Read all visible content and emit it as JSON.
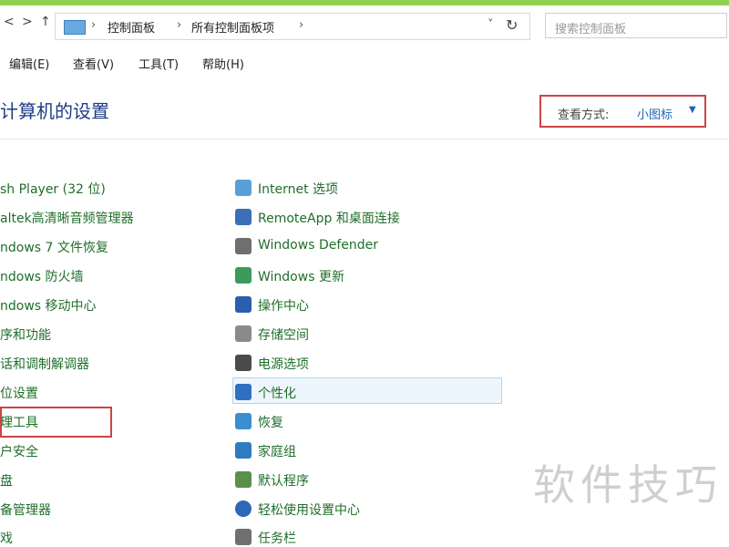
{
  "address_bar": {
    "back_symbol": "<",
    "forward_symbol": ">",
    "up_symbol": "↑",
    "breadcrumbs": [
      "控制面板",
      "所有控制面板项"
    ],
    "search_placeholder": "搜索控制面板",
    "refresh_symbol": "↻"
  },
  "menu": [
    "编辑(E)",
    "查看(V)",
    "工具(T)",
    "帮助(H)"
  ],
  "header": {
    "title": "计算机的设置",
    "view_by_label": "查看方式:",
    "view_by_value": "小图标"
  },
  "left_items": [
    "sh Player (32 位)",
    "altek高清晰音频管理器",
    "ndows 7 文件恢复",
    "ndows 防火墙",
    "ndows 移动中心",
    "序和功能",
    "话和调制解调器",
    "位设置",
    "理工具",
    "户安全",
    "盘",
    "备管理器",
    "戏"
  ],
  "right_items": [
    "Internet 选项",
    "RemoteApp 和桌面连接",
    "Windows Defender",
    "Windows 更新",
    "操作中心",
    "存储空间",
    "电源选项",
    "个性化",
    "恢复",
    "家庭组",
    "默认程序",
    "轻松使用设置中心",
    "任务栏"
  ],
  "watermark": "软件技巧",
  "colors": {
    "link_green": "#1f6e2a",
    "title_blue": "#1e3b86",
    "highlight_red": "#cc4444",
    "top_accent": "#8fd14f"
  }
}
